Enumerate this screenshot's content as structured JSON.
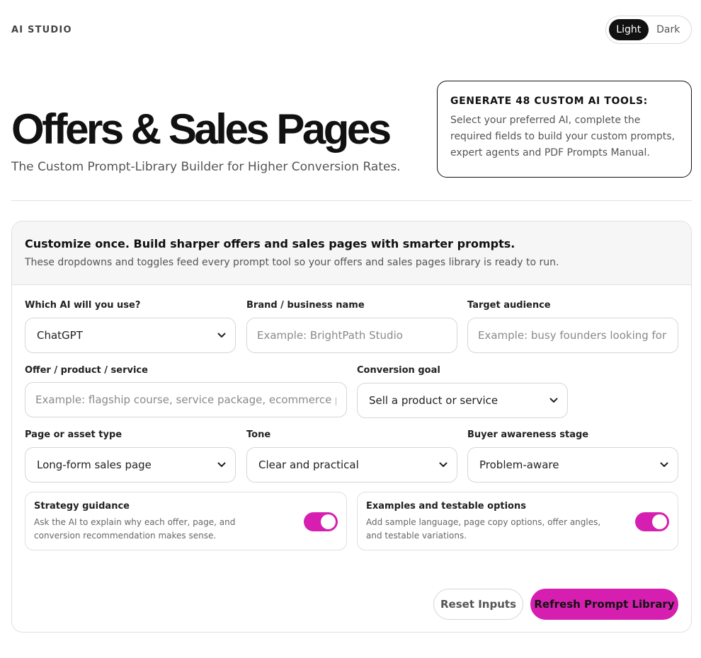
{
  "header": {
    "brand": "AI STUDIO",
    "theme": {
      "light": "Light",
      "dark": "Dark",
      "selected": "Light"
    }
  },
  "hero": {
    "title": "Offers & Sales Pages",
    "subtitle": "The Custom Prompt-Library Builder for Higher Conversion Rates."
  },
  "info_card": {
    "title": "GENERATE 48 CUSTOM AI TOOLS:",
    "text": "Select your preferred AI, complete the required fields to build your custom prompts, expert agents and PDF Prompts Manual."
  },
  "panel": {
    "heading": "Customize once. Build sharper offers and sales pages with smarter prompts.",
    "subheading": "These dropdowns and toggles feed every prompt tool so your offers and sales pages library is ready to run."
  },
  "fields": {
    "ai": {
      "label": "Which AI will you use?",
      "value": "ChatGPT"
    },
    "brand": {
      "label": "Brand / business name",
      "placeholder": "Example: BrightPath Studio",
      "value": ""
    },
    "audience": {
      "label": "Target audience",
      "placeholder": "Example: busy founders looking for better",
      "value": ""
    },
    "offer": {
      "label": "Offer / product / service",
      "placeholder": "Example: flagship course, service package, ecommerce product",
      "value": ""
    },
    "goal": {
      "label": "Conversion goal",
      "value": "Sell a product or service"
    },
    "page_type": {
      "label": "Page or asset type",
      "value": "Long-form sales page"
    },
    "tone": {
      "label": "Tone",
      "value": "Clear and practical"
    },
    "awareness": {
      "label": "Buyer awareness stage",
      "value": "Problem-aware"
    }
  },
  "toggles": {
    "strategy": {
      "title": "Strategy guidance",
      "description": "Ask the AI to explain why each offer, page, and conversion recommendation makes sense.",
      "on": true
    },
    "examples": {
      "title": "Examples and testable options",
      "description": "Add sample language, page copy options, offer angles, and testable variations.",
      "on": true
    }
  },
  "actions": {
    "reset": "Reset Inputs",
    "refresh": "Refresh Prompt Library"
  },
  "colors": {
    "accent": "#d61fb0",
    "text": "#111111",
    "muted": "#555555",
    "border": "#d6d6d6"
  },
  "icons": {
    "select_arrow": "chevron-down-icon"
  }
}
